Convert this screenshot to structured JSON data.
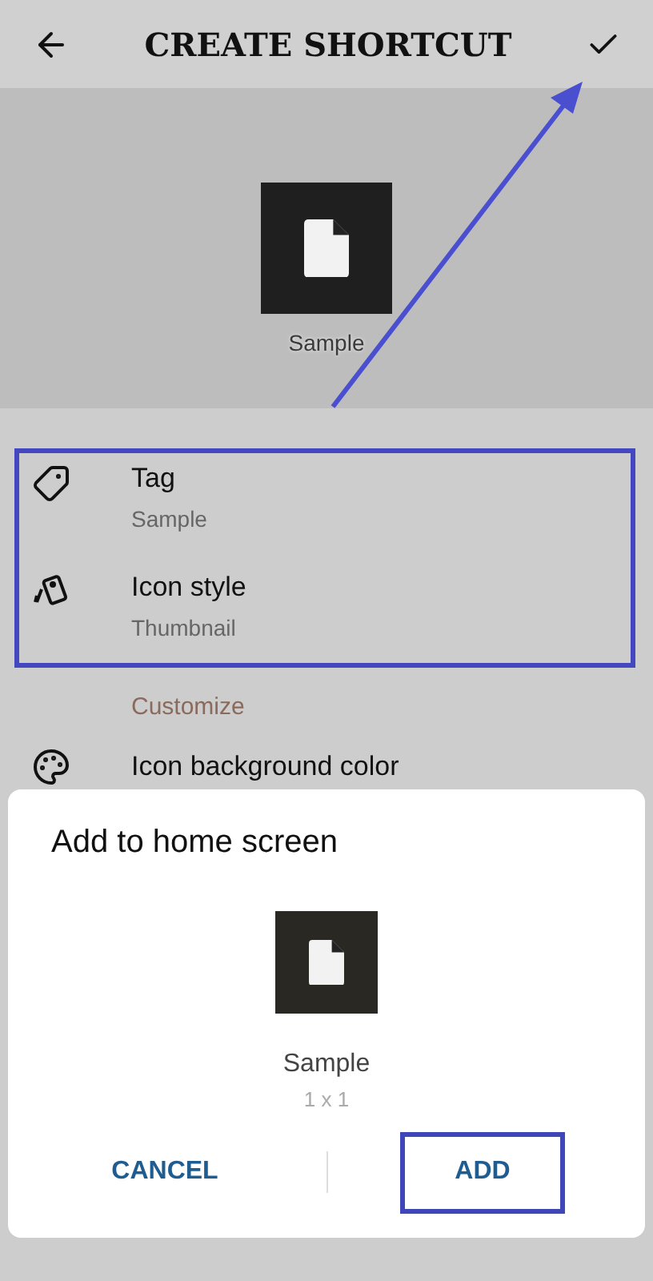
{
  "header": {
    "title": "CREATE SHORTCUT"
  },
  "preview": {
    "label": "Sample"
  },
  "settings": [
    {
      "kind": "tag",
      "title": "Tag",
      "value": "Sample"
    },
    {
      "kind": "style",
      "title": "Icon style",
      "value": "Thumbnail"
    }
  ],
  "section": {
    "title": "Customize"
  },
  "partial_item": {
    "title": "Icon background color"
  },
  "dialog": {
    "title": "Add to home screen",
    "label": "Sample",
    "size": "1 x 1",
    "buttons": [
      {
        "label": "CANCEL",
        "highlighted": false
      },
      {
        "label": "ADD",
        "highlighted": true
      }
    ]
  }
}
